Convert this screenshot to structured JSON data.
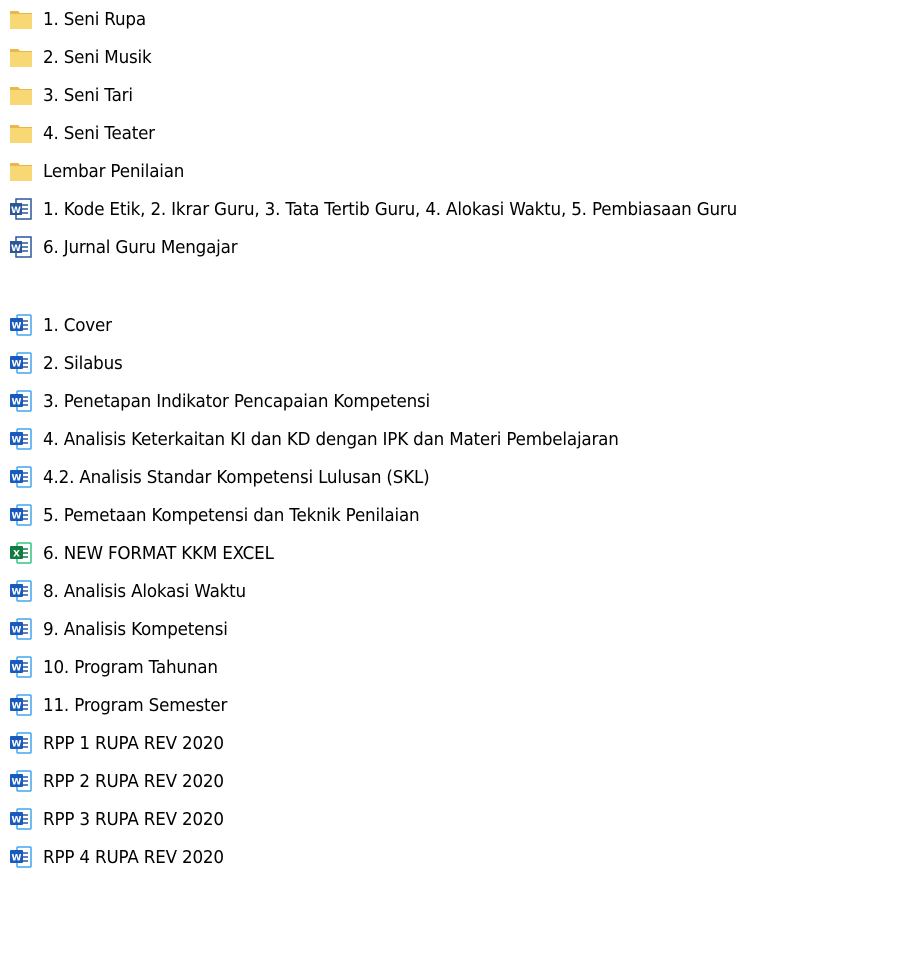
{
  "colors": {
    "folder_fill": "#F8D775",
    "folder_back": "#E8B84A",
    "word_blue": "#2B579A",
    "word_light": "#41A5EE",
    "excel_green": "#217346"
  },
  "folders": [
    {
      "label": "1. Seni Rupa",
      "icon": "folder-icon"
    },
    {
      "label": "2. Seni Musik",
      "icon": "folder-icon"
    },
    {
      "label": "3. Seni Tari",
      "icon": "folder-icon"
    },
    {
      "label": "4. Seni Teater",
      "icon": "folder-icon"
    },
    {
      "label": "Lembar Penilaian",
      "icon": "folder-icon"
    }
  ],
  "group1": [
    {
      "label": "1. Kode Etik, 2. Ikrar Guru, 3. Tata Tertib Guru, 4. Alokasi Waktu, 5. Pembiasaan Guru",
      "icon": "word-doc-icon"
    },
    {
      "label": "6. Jurnal Guru Mengajar",
      "icon": "word-doc-icon"
    }
  ],
  "group2": [
    {
      "label": "1. Cover",
      "icon": "word-doc-icon"
    },
    {
      "label": "2. Silabus",
      "icon": "word-doc-icon"
    },
    {
      "label": "3. Penetapan Indikator Pencapaian Kompetensi",
      "icon": "word-doc-icon"
    },
    {
      "label": "4. Analisis Keterkaitan KI dan KD dengan IPK dan Materi Pembelajaran",
      "icon": "word-doc-icon"
    },
    {
      "label": "4.2. Analisis Standar Kompetensi Lulusan (SKL)",
      "icon": "word-doc-icon"
    },
    {
      "label": "5. Pemetaan Kompetensi dan Teknik Penilaian",
      "icon": "word-doc-icon"
    },
    {
      "label": "6. NEW FORMAT KKM EXCEL",
      "icon": "excel-doc-icon"
    },
    {
      "label": "8. Analisis Alokasi Waktu",
      "icon": "word-doc-icon"
    },
    {
      "label": "9. Analisis Kompetensi",
      "icon": "word-doc-icon"
    },
    {
      "label": "10. Program Tahunan",
      "icon": "word-doc-icon"
    },
    {
      "label": "11. Program Semester",
      "icon": "word-doc-icon"
    },
    {
      "label": "RPP 1 RUPA REV 2020",
      "icon": "word-doc-icon"
    },
    {
      "label": "RPP 2 RUPA REV 2020",
      "icon": "word-doc-icon"
    },
    {
      "label": "RPP 3 RUPA REV 2020",
      "icon": "word-doc-icon"
    },
    {
      "label": "RPP 4 RUPA REV 2020",
      "icon": "word-doc-icon"
    }
  ]
}
